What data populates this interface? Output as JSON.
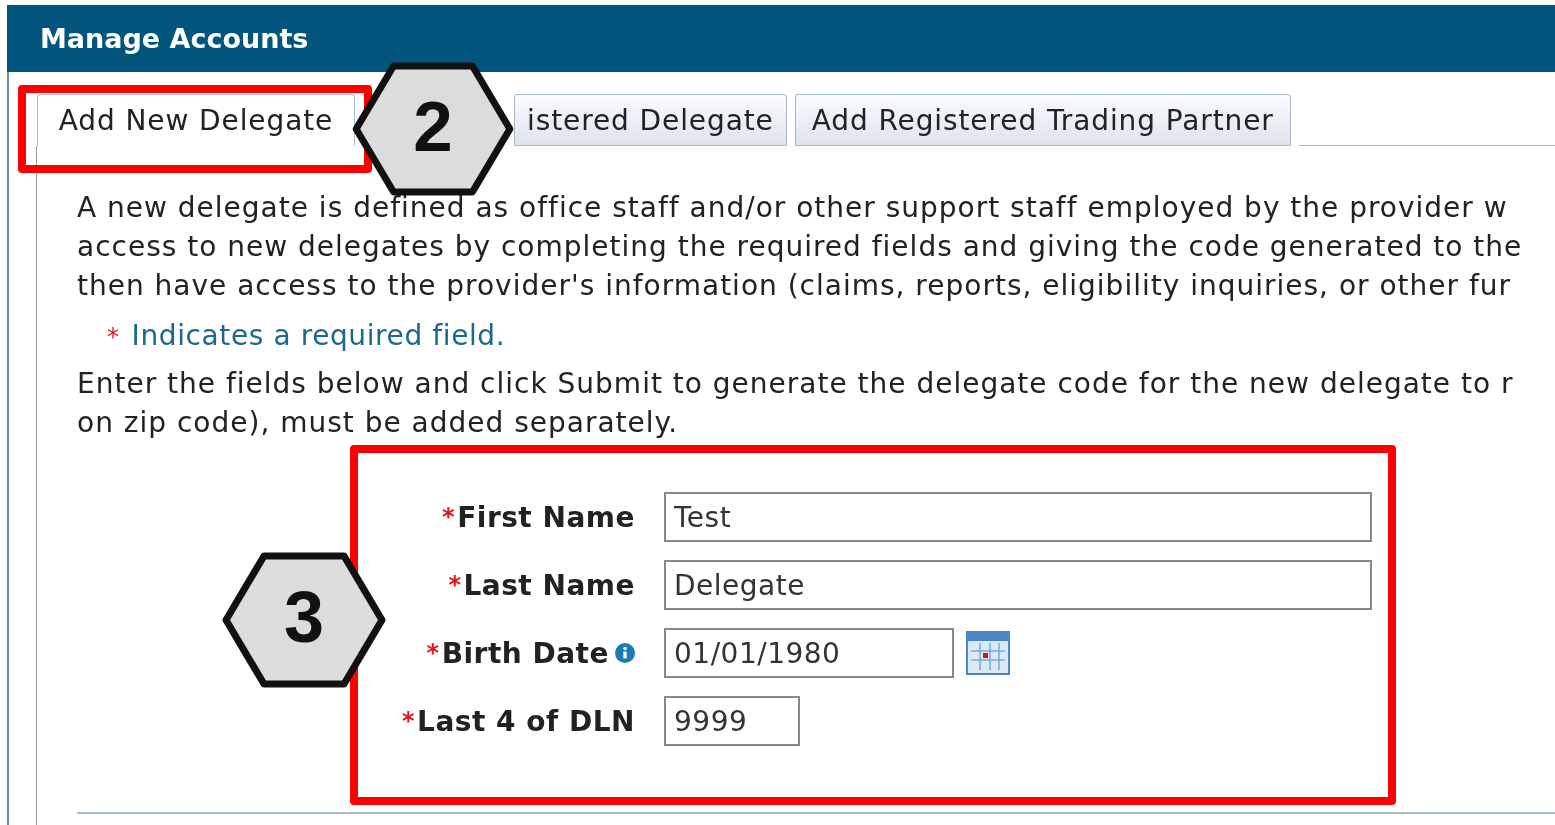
{
  "header": {
    "title": "Manage Accounts"
  },
  "tabs": [
    {
      "label": "Add New Delegate",
      "selected": true
    },
    {
      "label": "istered Delegate",
      "selected": false
    },
    {
      "label": "Add Registered Trading Partner",
      "selected": false
    }
  ],
  "intro_lines": [
    "A new delegate is defined as office staff and/or other support staff employed by the provider w",
    "access to new delegates by completing the required fields and giving the code generated to the",
    "then have access to the provider's information (claims, reports, eligibility inquiries, or other fur"
  ],
  "required_note": {
    "mark": "*",
    "text": "Indicates a required field."
  },
  "instruction_lines": [
    "Enter the fields below and click Submit to generate the delegate code for the new delegate to r",
    "on zip code), must be added separately."
  ],
  "form": [
    {
      "kind": "text",
      "mark": "*",
      "label": "First Name",
      "value": "Test"
    },
    {
      "kind": "text",
      "mark": "*",
      "label": "Last Name",
      "value": "Delegate"
    },
    {
      "kind": "date",
      "mark": "*",
      "label": "Birth Date",
      "value": "01/01/1980"
    },
    {
      "kind": "short",
      "mark": "*",
      "label": "Last 4 of DLN",
      "value": "9999"
    }
  ],
  "callouts": [
    {
      "number": "2"
    },
    {
      "number": "3"
    }
  ]
}
